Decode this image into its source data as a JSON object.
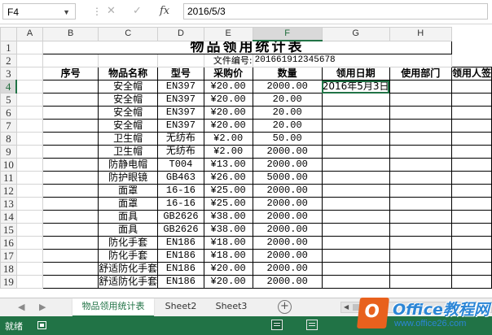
{
  "formula_bar": {
    "name_box": "F4",
    "fx_label": "fx",
    "cancel_glyph": "✕",
    "enter_glyph": "✓",
    "separator": "⋮",
    "formula": "2016/5/3"
  },
  "columns": [
    "A",
    "B",
    "C",
    "D",
    "E",
    "F",
    "G",
    "H"
  ],
  "selected_column": "F",
  "selected_row": 4,
  "rows": [
    "1",
    "2",
    "3",
    "4",
    "5",
    "6",
    "7",
    "8",
    "9",
    "10",
    "11",
    "12",
    "13",
    "14",
    "15",
    "16",
    "17",
    "18",
    "19"
  ],
  "sheet": {
    "title": "物品领用统计表",
    "doc_no_label": "文件编号:",
    "doc_no": "201661912345678",
    "headers": [
      "序号",
      "物品名称",
      "型号",
      "采购价",
      "数量",
      "领用日期",
      "使用部门",
      "领用人签"
    ],
    "items": [
      {
        "name": "安全帽",
        "model": "EN397",
        "price": "¥20.00",
        "qty": "2000.00",
        "date": "2016年5月3日"
      },
      {
        "name": "安全帽",
        "model": "EN397",
        "price": "¥20.00",
        "qty": "20.00",
        "date": ""
      },
      {
        "name": "安全帽",
        "model": "EN397",
        "price": "¥20.00",
        "qty": "20.00",
        "date": ""
      },
      {
        "name": "安全帽",
        "model": "EN397",
        "price": "¥20.00",
        "qty": "20.00",
        "date": ""
      },
      {
        "name": "卫生帽",
        "model": "无纺布",
        "price": "¥2.00",
        "qty": "50.00",
        "date": ""
      },
      {
        "name": "卫生帽",
        "model": "无纺布",
        "price": "¥2.00",
        "qty": "2000.00",
        "date": ""
      },
      {
        "name": "防静电帽",
        "model": "T004",
        "price": "¥13.00",
        "qty": "2000.00",
        "date": ""
      },
      {
        "name": "防护眼镜",
        "model": "GB463",
        "price": "¥26.00",
        "qty": "5000.00",
        "date": ""
      },
      {
        "name": "面罩",
        "model": "16-16",
        "price": "¥25.00",
        "qty": "2000.00",
        "date": ""
      },
      {
        "name": "面罩",
        "model": "16-16",
        "price": "¥25.00",
        "qty": "2000.00",
        "date": ""
      },
      {
        "name": "面具",
        "model": "GB2626",
        "price": "¥38.00",
        "qty": "2000.00",
        "date": ""
      },
      {
        "name": "面具",
        "model": "GB2626",
        "price": "¥38.00",
        "qty": "2000.00",
        "date": ""
      },
      {
        "name": "防化手套",
        "model": "EN186",
        "price": "¥18.00",
        "qty": "2000.00",
        "date": ""
      },
      {
        "name": "防化手套",
        "model": "EN186",
        "price": "¥18.00",
        "qty": "2000.00",
        "date": ""
      },
      {
        "name": "舒适防化手套",
        "model": "EN186",
        "price": "¥20.00",
        "qty": "2000.00",
        "date": ""
      },
      {
        "name": "舒适防化手套",
        "model": "EN186",
        "price": "¥20.00",
        "qty": "2000.00",
        "date": ""
      }
    ]
  },
  "tabs": {
    "prev": "◀",
    "next": "▶",
    "items": [
      "物品领用统计表",
      "Sheet2",
      "Sheet3"
    ],
    "add": "+"
  },
  "status": {
    "ready": "就绪"
  },
  "watermark": {
    "letter": "O",
    "brand": "Office教程网",
    "url": "www.office26.com"
  },
  "colors": {
    "excel_green": "#217346",
    "watermark_orange": "#e8611d",
    "watermark_blue": "#2c86d6"
  }
}
